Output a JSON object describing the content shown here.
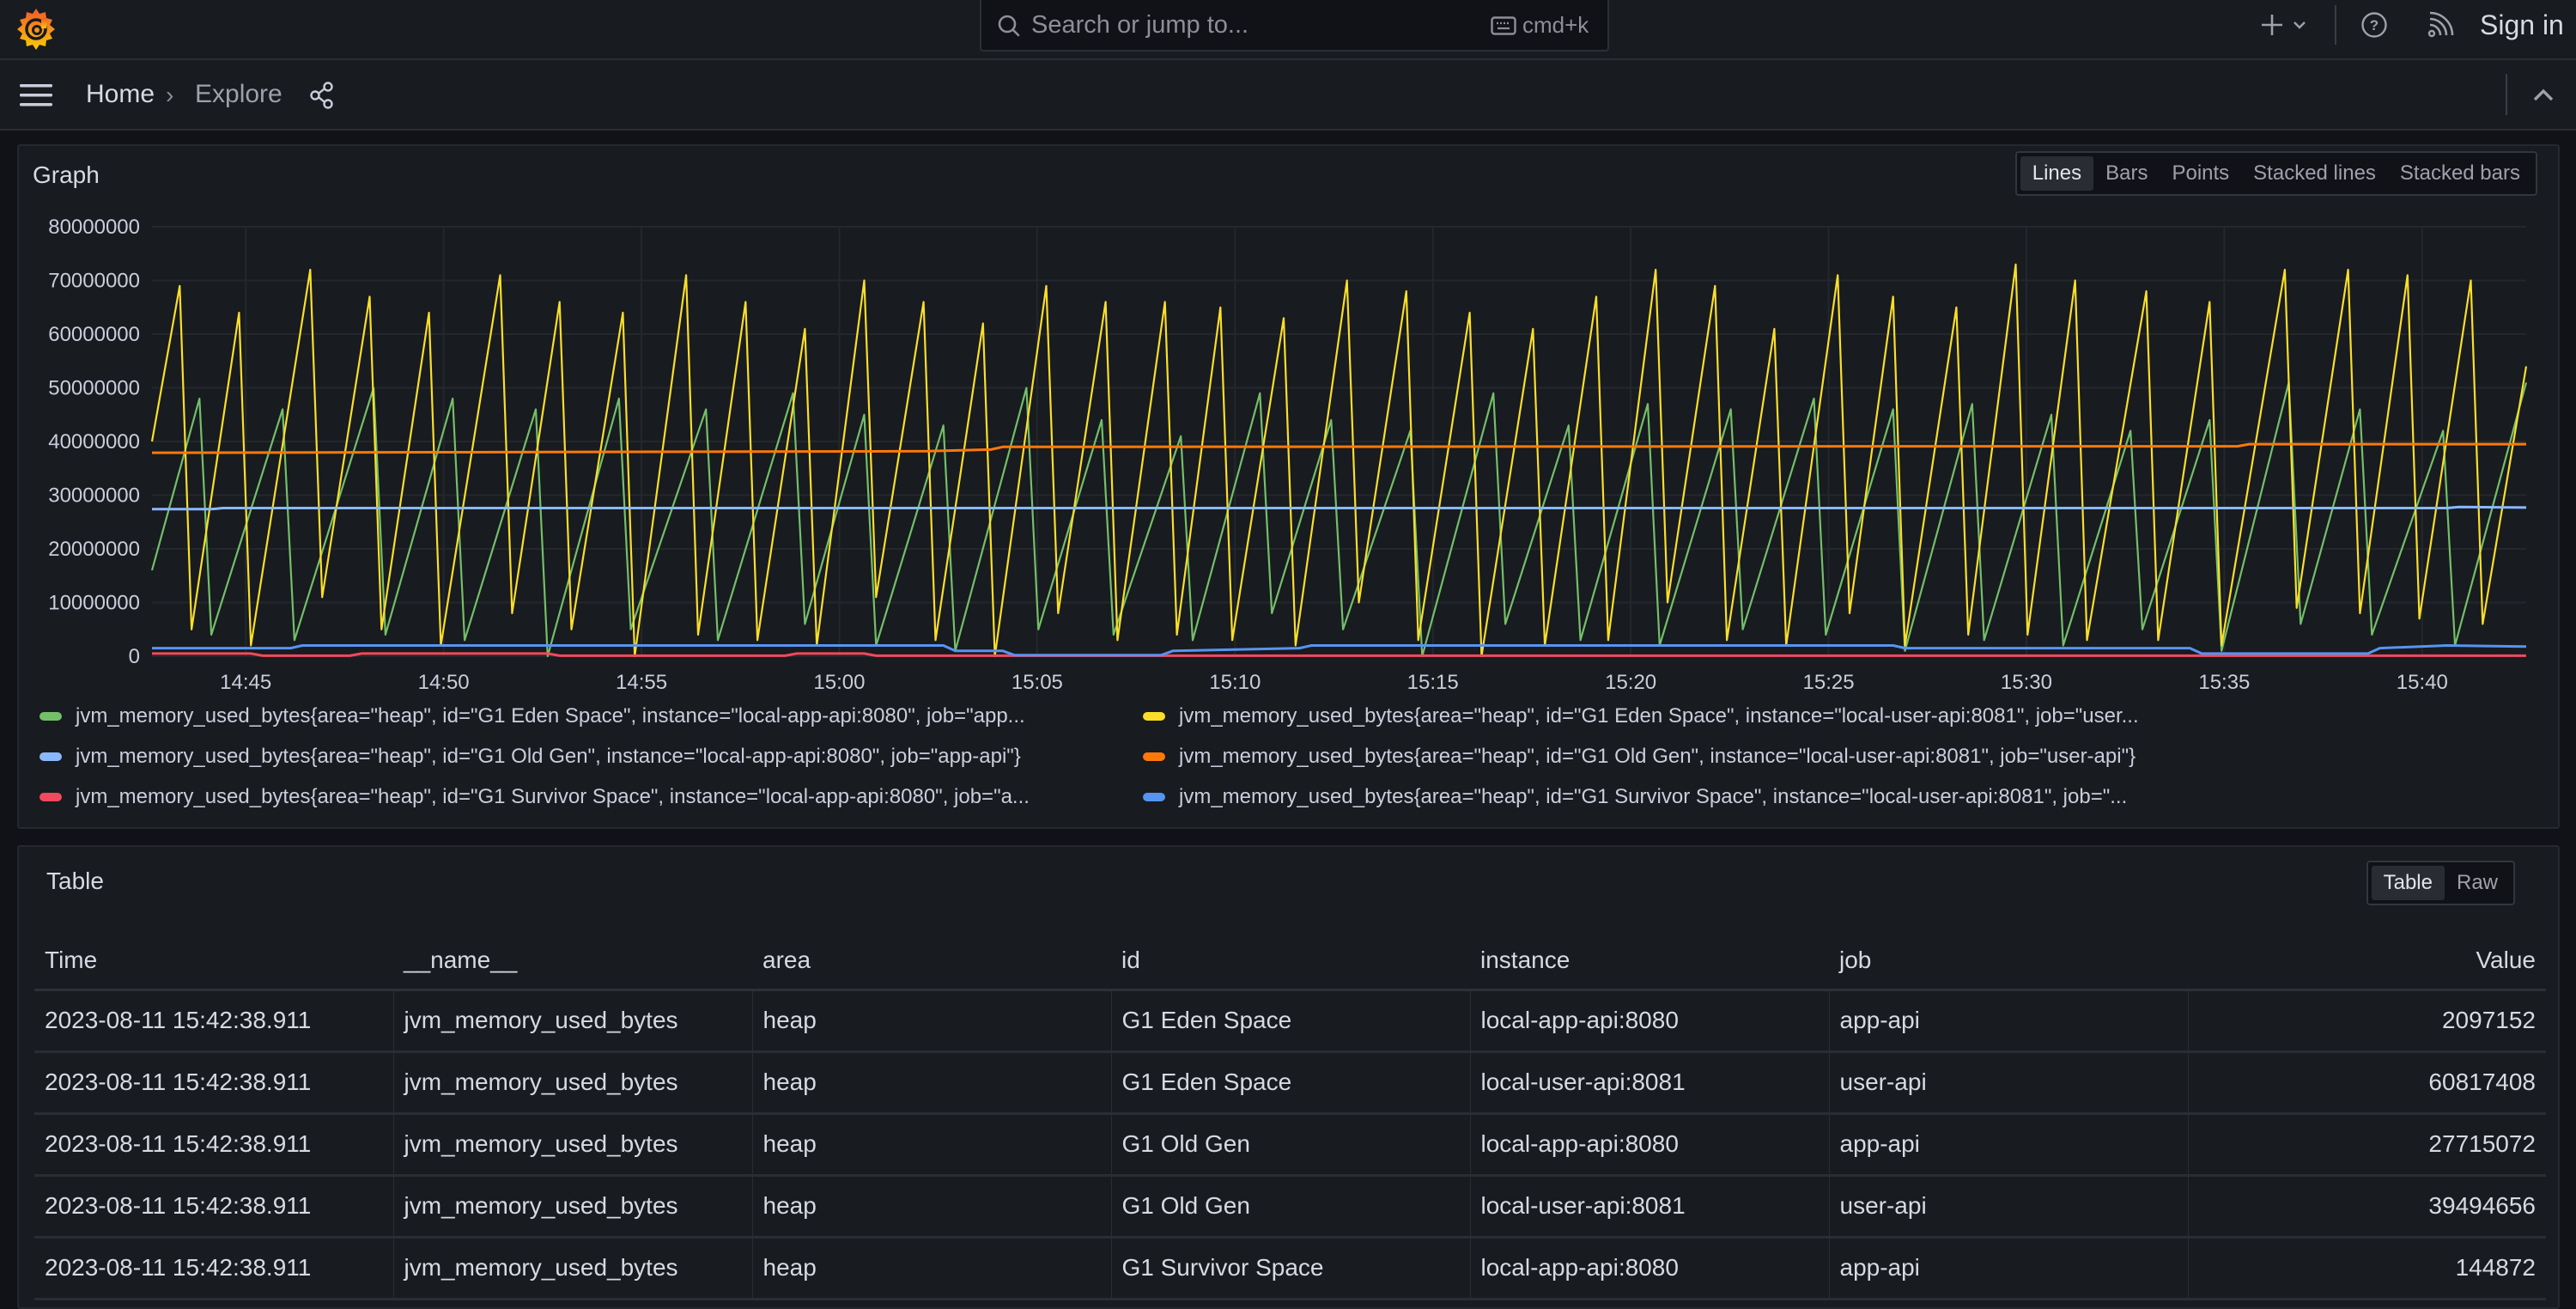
{
  "topbar": {
    "logo": "grafana-logo",
    "search_placeholder": "Search or jump to...",
    "search_shortcut": "cmd+k",
    "sign_in": "Sign in"
  },
  "breadcrumb": {
    "home": "Home",
    "separator": "›",
    "current": "Explore"
  },
  "graph_panel": {
    "title": "Graph",
    "view_options": [
      "Lines",
      "Bars",
      "Points",
      "Stacked lines",
      "Stacked bars"
    ],
    "active_view": "Lines"
  },
  "table_panel": {
    "title": "Table",
    "view_options": [
      "Table",
      "Raw"
    ],
    "active_view": "Table",
    "columns": [
      "Time",
      "__name__",
      "area",
      "id",
      "instance",
      "job",
      "Value"
    ],
    "rows": [
      [
        "2023-08-11 15:42:38.911",
        "jvm_memory_used_bytes",
        "heap",
        "G1 Eden Space",
        "local-app-api:8080",
        "app-api",
        "2097152"
      ],
      [
        "2023-08-11 15:42:38.911",
        "jvm_memory_used_bytes",
        "heap",
        "G1 Eden Space",
        "local-user-api:8081",
        "user-api",
        "60817408"
      ],
      [
        "2023-08-11 15:42:38.911",
        "jvm_memory_used_bytes",
        "heap",
        "G1 Old Gen",
        "local-app-api:8080",
        "app-api",
        "27715072"
      ],
      [
        "2023-08-11 15:42:38.911",
        "jvm_memory_used_bytes",
        "heap",
        "G1 Old Gen",
        "local-user-api:8081",
        "user-api",
        "39494656"
      ],
      [
        "2023-08-11 15:42:38.911",
        "jvm_memory_used_bytes",
        "heap",
        "G1 Survivor Space",
        "local-app-api:8080",
        "app-api",
        "144872"
      ]
    ]
  },
  "chart_data": {
    "type": "line",
    "title": "Graph",
    "xlabel": "",
    "ylabel": "",
    "x_unit": "minutes since 14:42:38",
    "xlim": [
      0,
      60
    ],
    "ylim": [
      0,
      80000000
    ],
    "y_ticks": [
      "0",
      "10000000",
      "20000000",
      "30000000",
      "40000000",
      "50000000",
      "60000000",
      "70000000",
      "80000000"
    ],
    "x_ticks": [
      {
        "label": "14:45",
        "x": 2.37
      },
      {
        "label": "14:50",
        "x": 7.37
      },
      {
        "label": "14:55",
        "x": 12.37
      },
      {
        "label": "15:00",
        "x": 17.37
      },
      {
        "label": "15:05",
        "x": 22.37
      },
      {
        "label": "15:10",
        "x": 27.37
      },
      {
        "label": "15:15",
        "x": 32.37
      },
      {
        "label": "15:20",
        "x": 37.37
      },
      {
        "label": "15:25",
        "x": 42.37
      },
      {
        "label": "15:30",
        "x": 47.37
      },
      {
        "label": "15:35",
        "x": 52.37
      },
      {
        "label": "15:40",
        "x": 57.37
      }
    ],
    "grid": true,
    "legend_position": "bottom",
    "series": [
      {
        "name": "jvm_memory_used_bytes{area=\"heap\", id=\"G1 Eden Space\", instance=\"local-app-api:8080\", job=\"app...",
        "color": "#73bf69",
        "points": [
          [
            0,
            16000000
          ],
          [
            1.2,
            48000000
          ],
          [
            1.5,
            4000000
          ],
          [
            3.3,
            46000000
          ],
          [
            3.6,
            3000000
          ],
          [
            5.6,
            50000000
          ],
          [
            5.9,
            4000000
          ],
          [
            7.6,
            48000000
          ],
          [
            7.9,
            3000000
          ],
          [
            9.7,
            46000000
          ],
          [
            10.0,
            0
          ],
          [
            11.8,
            48000000
          ],
          [
            12.1,
            5000000
          ],
          [
            14.0,
            46000000
          ],
          [
            14.3,
            3000000
          ],
          [
            16.2,
            49000000
          ],
          [
            16.5,
            6000000
          ],
          [
            18.0,
            45000000
          ],
          [
            18.3,
            2000000
          ],
          [
            20.0,
            43000000
          ],
          [
            20.3,
            1000000
          ],
          [
            22.1,
            50000000
          ],
          [
            22.4,
            5000000
          ],
          [
            24.0,
            44000000
          ],
          [
            24.3,
            4000000
          ],
          [
            26.0,
            41000000
          ],
          [
            26.3,
            3000000
          ],
          [
            28.0,
            49000000
          ],
          [
            28.3,
            8000000
          ],
          [
            29.8,
            44000000
          ],
          [
            30.1,
            5000000
          ],
          [
            31.8,
            42000000
          ],
          [
            32.1,
            0
          ],
          [
            33.9,
            49000000
          ],
          [
            34.2,
            6000000
          ],
          [
            35.8,
            43000000
          ],
          [
            36.1,
            3000000
          ],
          [
            37.8,
            47000000
          ],
          [
            38.1,
            2000000
          ],
          [
            39.9,
            46000000
          ],
          [
            40.2,
            5000000
          ],
          [
            42.0,
            48000000
          ],
          [
            42.3,
            4000000
          ],
          [
            44.0,
            46000000
          ],
          [
            44.3,
            1000000
          ],
          [
            46.0,
            47000000
          ],
          [
            46.3,
            3000000
          ],
          [
            48.0,
            45000000
          ],
          [
            48.3,
            2000000
          ],
          [
            50.0,
            42000000
          ],
          [
            50.3,
            5000000
          ],
          [
            52.0,
            44000000
          ],
          [
            52.3,
            1000000
          ],
          [
            54.0,
            51000000
          ],
          [
            54.3,
            6000000
          ],
          [
            55.8,
            46000000
          ],
          [
            56.1,
            4000000
          ],
          [
            57.9,
            42000000
          ],
          [
            58.2,
            2000000
          ],
          [
            60,
            51000000
          ]
        ]
      },
      {
        "name": "jvm_memory_used_bytes{area=\"heap\", id=\"G1 Eden Space\", instance=\"local-user-api:8081\", job=\"user...",
        "color": "#fade2a",
        "points": [
          [
            0,
            40000000
          ],
          [
            0.7,
            69000000
          ],
          [
            1.0,
            5000000
          ],
          [
            2.2,
            64000000
          ],
          [
            2.5,
            2000000
          ],
          [
            4.0,
            72000000
          ],
          [
            4.3,
            11000000
          ],
          [
            5.5,
            67000000
          ],
          [
            5.8,
            5000000
          ],
          [
            7.0,
            64000000
          ],
          [
            7.3,
            2000000
          ],
          [
            8.8,
            71000000
          ],
          [
            9.1,
            8000000
          ],
          [
            10.3,
            66000000
          ],
          [
            10.6,
            5000000
          ],
          [
            11.9,
            64000000
          ],
          [
            12.2,
            0
          ],
          [
            13.5,
            71000000
          ],
          [
            13.8,
            4000000
          ],
          [
            15.0,
            66000000
          ],
          [
            15.3,
            3000000
          ],
          [
            16.5,
            61000000
          ],
          [
            16.8,
            2000000
          ],
          [
            18.0,
            70000000
          ],
          [
            18.3,
            11000000
          ],
          [
            19.5,
            66000000
          ],
          [
            19.8,
            3000000
          ],
          [
            21.0,
            62000000
          ],
          [
            21.3,
            0
          ],
          [
            22.6,
            69000000
          ],
          [
            22.9,
            8000000
          ],
          [
            24.1,
            66000000
          ],
          [
            24.4,
            3000000
          ],
          [
            25.6,
            66000000
          ],
          [
            25.9,
            4000000
          ],
          [
            27.0,
            65000000
          ],
          [
            27.3,
            3000000
          ],
          [
            28.6,
            63000000
          ],
          [
            28.9,
            2000000
          ],
          [
            30.2,
            70000000
          ],
          [
            30.5,
            10000000
          ],
          [
            31.7,
            68000000
          ],
          [
            32.0,
            3000000
          ],
          [
            33.3,
            64000000
          ],
          [
            33.6,
            0
          ],
          [
            34.9,
            61000000
          ],
          [
            35.2,
            2000000
          ],
          [
            36.5,
            67000000
          ],
          [
            36.8,
            3000000
          ],
          [
            38.0,
            72000000
          ],
          [
            38.3,
            10000000
          ],
          [
            39.5,
            69000000
          ],
          [
            39.8,
            3000000
          ],
          [
            41.0,
            61000000
          ],
          [
            41.3,
            2000000
          ],
          [
            42.6,
            71000000
          ],
          [
            42.9,
            8000000
          ],
          [
            44.0,
            67000000
          ],
          [
            44.3,
            2000000
          ],
          [
            45.6,
            65000000
          ],
          [
            45.9,
            4000000
          ],
          [
            47.1,
            73000000
          ],
          [
            47.4,
            4000000
          ],
          [
            48.6,
            70000000
          ],
          [
            48.9,
            3000000
          ],
          [
            50.4,
            68000000
          ],
          [
            50.7,
            3000000
          ],
          [
            52.0,
            66000000
          ],
          [
            52.3,
            2000000
          ],
          [
            53.9,
            72000000
          ],
          [
            54.2,
            9000000
          ],
          [
            55.5,
            72000000
          ],
          [
            55.8,
            8000000
          ],
          [
            57.0,
            71000000
          ],
          [
            57.3,
            7000000
          ],
          [
            58.6,
            70000000
          ],
          [
            58.9,
            6000000
          ],
          [
            60,
            54000000
          ]
        ]
      },
      {
        "name": "jvm_memory_used_bytes{area=\"heap\", id=\"G1 Old Gen\", instance=\"local-app-api:8080\", job=\"app-api\"}",
        "color": "#8ab8ff",
        "points": [
          [
            0,
            27400000
          ],
          [
            1.5,
            27400000
          ],
          [
            1.8,
            27600000
          ],
          [
            58,
            27600000
          ],
          [
            58.3,
            27800000
          ],
          [
            60,
            27700000
          ]
        ]
      },
      {
        "name": "jvm_memory_used_bytes{area=\"heap\", id=\"G1 Old Gen\", instance=\"local-user-api:8081\", job=\"user-api\"}",
        "color": "#ff780a",
        "points": [
          [
            0,
            37900000
          ],
          [
            7.9,
            38000000
          ],
          [
            19.6,
            38200000
          ],
          [
            21.2,
            38500000
          ],
          [
            21.5,
            39000000
          ],
          [
            45,
            39100000
          ],
          [
            52.7,
            39100000
          ],
          [
            53.0,
            39500000
          ],
          [
            60,
            39500000
          ]
        ]
      },
      {
        "name": "jvm_memory_used_bytes{area=\"heap\", id=\"G1 Survivor Space\", instance=\"local-app-api:8080\", job=\"a...",
        "color": "#f2495c",
        "points": [
          [
            0,
            500000
          ],
          [
            2.5,
            500000
          ],
          [
            2.8,
            100000
          ],
          [
            5.0,
            100000
          ],
          [
            5.3,
            500000
          ],
          [
            10.0,
            500000
          ],
          [
            10.3,
            100000
          ],
          [
            16.0,
            100000
          ],
          [
            16.3,
            500000
          ],
          [
            18.0,
            500000
          ],
          [
            18.3,
            100000
          ],
          [
            60,
            100000
          ]
        ]
      },
      {
        "name": "jvm_memory_used_bytes{area=\"heap\", id=\"G1 Survivor Space\", instance=\"local-user-api:8081\", job=\"...",
        "color": "#5794f2",
        "points": [
          [
            0,
            1500000
          ],
          [
            3.5,
            1500000
          ],
          [
            3.8,
            2000000
          ],
          [
            20.0,
            2000000
          ],
          [
            20.3,
            1000000
          ],
          [
            21.5,
            1000000
          ],
          [
            21.8,
            200000
          ],
          [
            25.5,
            200000
          ],
          [
            25.8,
            1000000
          ],
          [
            29.0,
            1500000
          ],
          [
            29.3,
            2000000
          ],
          [
            44.0,
            2000000
          ],
          [
            44.3,
            1500000
          ],
          [
            51.5,
            1500000
          ],
          [
            51.8,
            500000
          ],
          [
            56.0,
            500000
          ],
          [
            56.3,
            1500000
          ],
          [
            58.0,
            2000000
          ],
          [
            60,
            1800000
          ]
        ]
      }
    ]
  }
}
